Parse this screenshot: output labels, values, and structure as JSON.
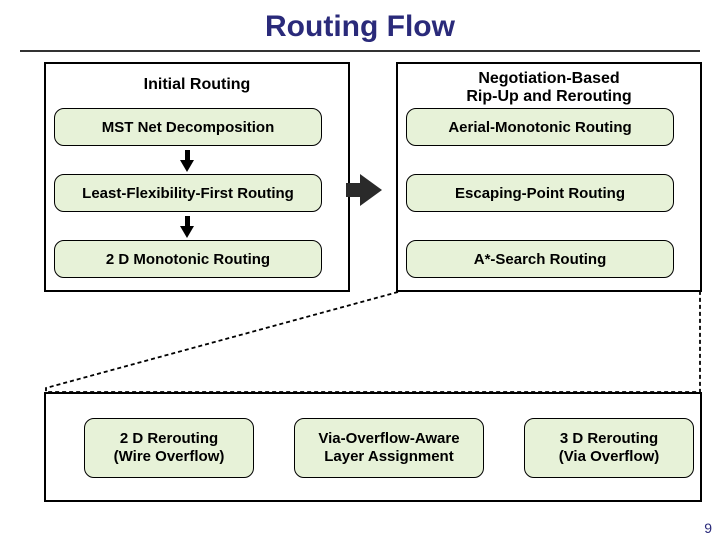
{
  "title": "Routing Flow",
  "left_panel": {
    "heading": "Initial Routing",
    "steps": [
      "MST Net Decomposition",
      "Least-Flexibility-First Routing",
      "2 D Monotonic Routing"
    ]
  },
  "right_panel": {
    "heading": "Negotiation-Based\nRip-Up and Rerouting",
    "steps": [
      "Aerial-Monotonic Routing",
      "Escaping-Point Routing",
      "A*-Search Routing"
    ]
  },
  "bottom_panel": {
    "steps": [
      "2 D Rerouting\n(Wire Overflow)",
      "Via-Overflow-Aware\nLayer Assignment",
      "3 D Rerouting\n(Via Overflow)"
    ]
  },
  "page_number": "9"
}
